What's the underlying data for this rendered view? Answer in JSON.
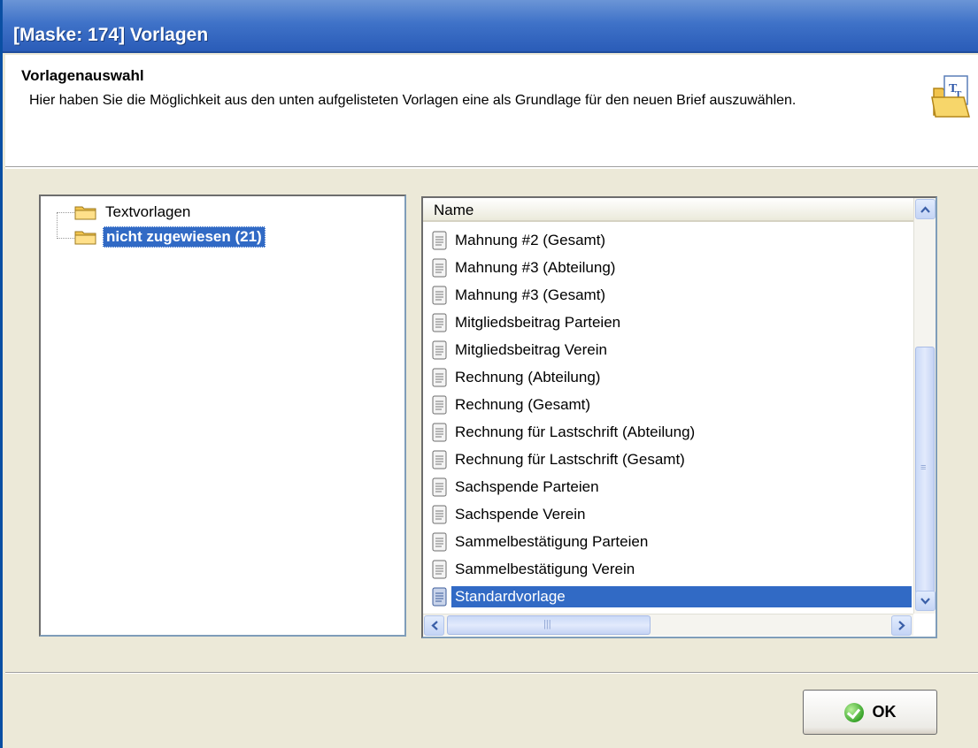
{
  "window": {
    "title": "[Maske: 174] Vorlagen"
  },
  "header": {
    "title": "Vorlagenauswahl",
    "description": "Hier haben Sie die Möglichkeit aus den unten aufgelisteten Vorlagen eine als Grundlage für den neuen Brief auszuwählen.",
    "icon": "text-document-icon"
  },
  "tree": {
    "items": [
      {
        "label": "Textvorlagen",
        "icon": "folder-icon",
        "selected": false
      },
      {
        "label": "nicht zugewiesen (21)",
        "icon": "folder-icon",
        "selected": true
      }
    ]
  },
  "list": {
    "column_header": "Name",
    "rows": [
      "Mahnung #2 (Gesamt)",
      "Mahnung #3 (Abteilung)",
      "Mahnung #3 (Gesamt)",
      "Mitgliedsbeitrag Parteien",
      "Mitgliedsbeitrag Verein",
      "Rechnung (Abteilung)",
      "Rechnung (Gesamt)",
      "Rechnung für Lastschrift (Abteilung)",
      "Rechnung für Lastschrift (Gesamt)",
      "Sachspende Parteien",
      "Sachspende Verein",
      "Sammelbestätigung Parteien",
      "Sammelbestätigung Verein",
      "Standardvorlage"
    ],
    "selected_index": 13
  },
  "footer": {
    "ok_label": "OK",
    "ok_icon": "checkmark-icon"
  },
  "colors": {
    "selection": "#316ac5",
    "titlebar": "#3f72c8"
  }
}
